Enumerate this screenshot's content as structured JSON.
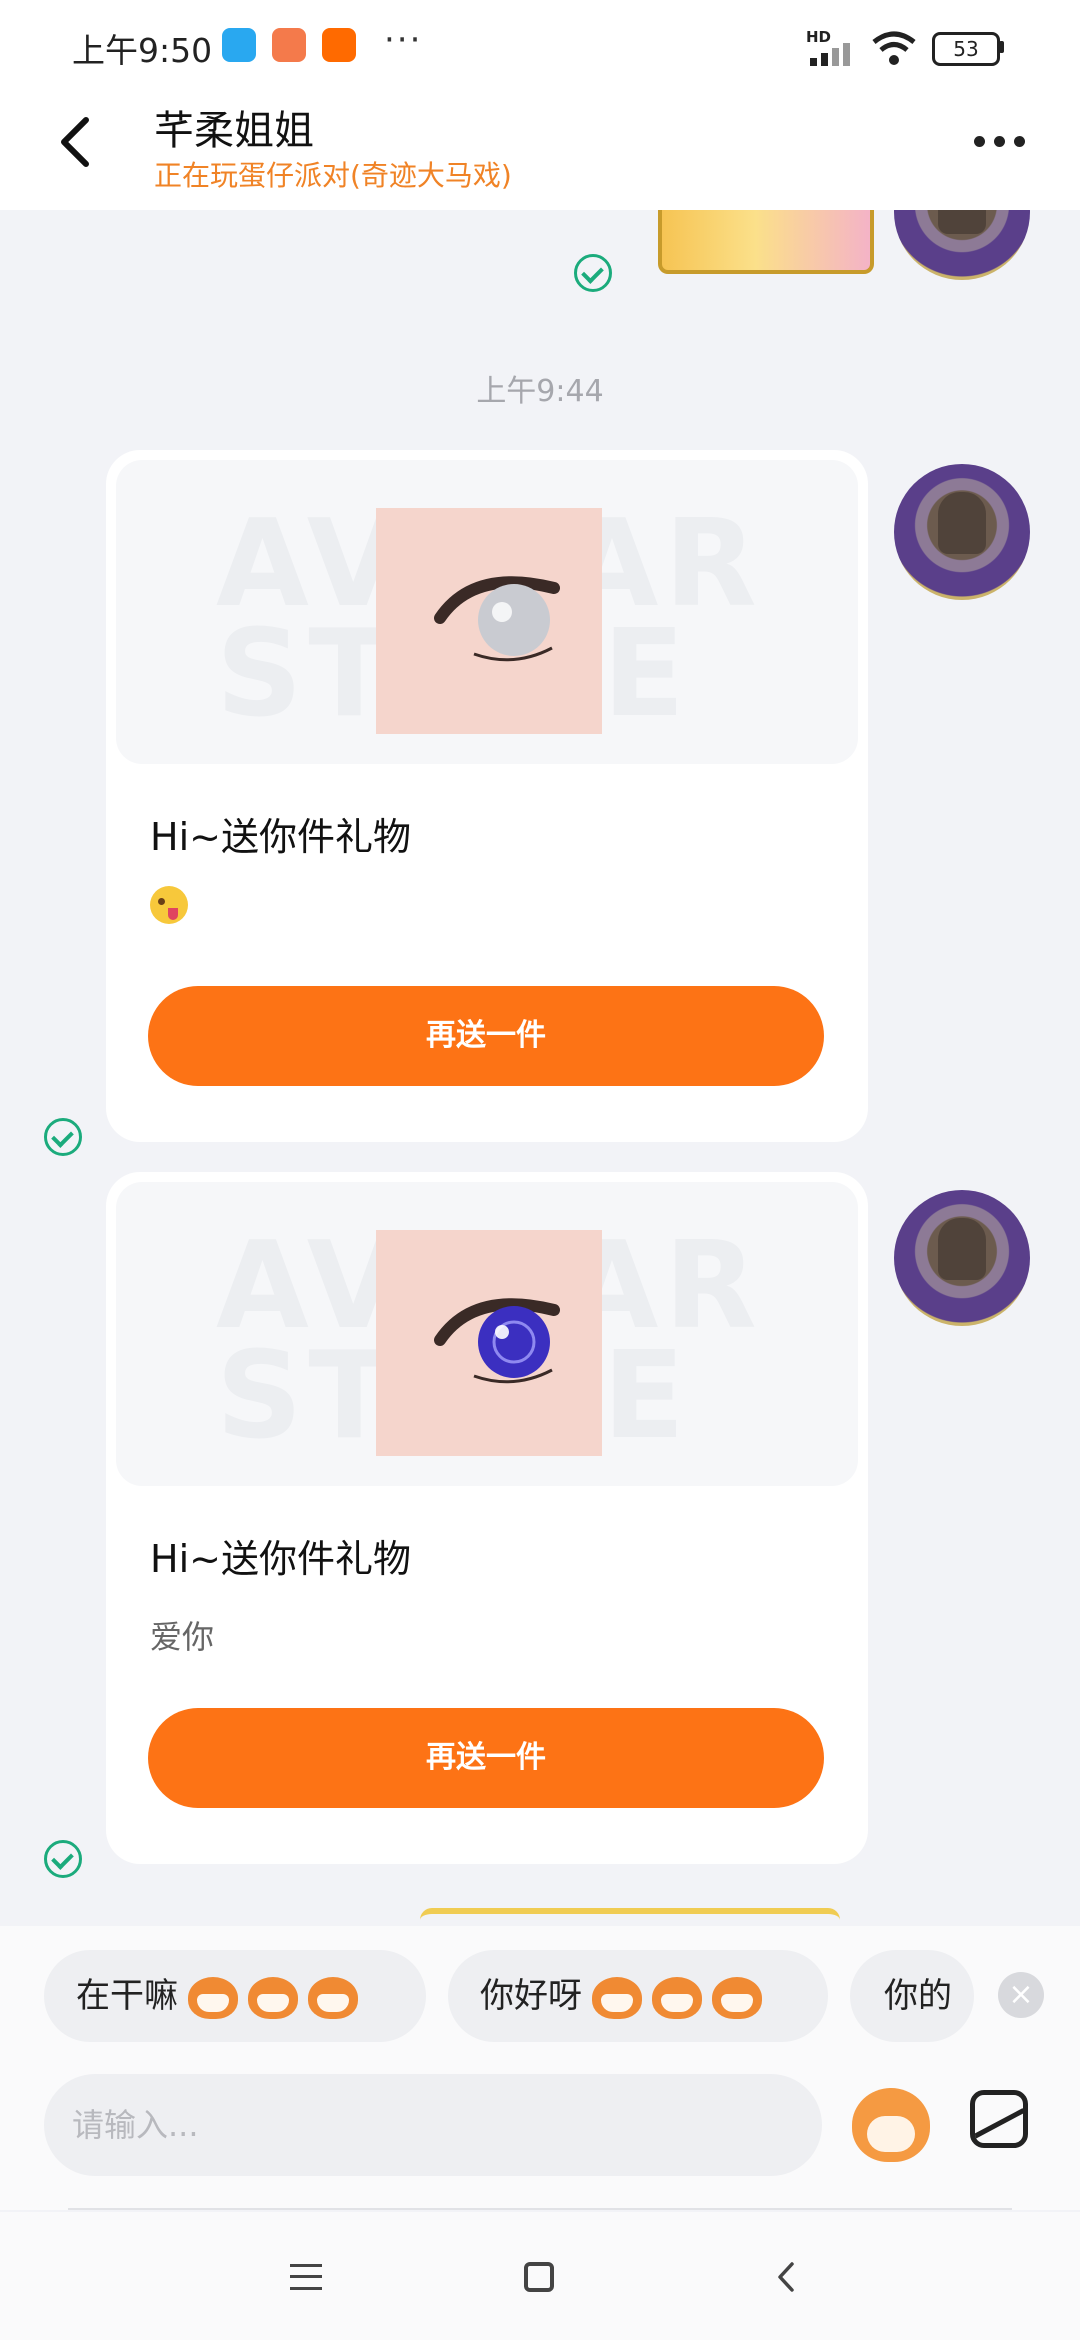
{
  "status_bar": {
    "time": "上午9:50",
    "more": "···",
    "network": "HD",
    "battery": "53"
  },
  "header": {
    "name": "芊柔姐姐",
    "status": "正在玩蛋仔派对(奇迹大马戏)"
  },
  "chat": {
    "timestamp": "上午9:44",
    "watermark": "AVATAR STORE",
    "messages": [
      {
        "title": "Hi~送你件礼物",
        "note": "",
        "button": "再送一件",
        "eye_color": "#c9cbd1"
      },
      {
        "title": "Hi~送你件礼物",
        "note": "爱你",
        "button": "再送一件",
        "eye_color": "#3b2fc0"
      }
    ]
  },
  "quick_replies": [
    "在干嘛",
    "你好呀",
    "你的"
  ],
  "input": {
    "placeholder": "请输入..."
  },
  "colors": {
    "accent": "#fd7315",
    "status_text": "#f08326",
    "sent_check": "#1bab7c"
  },
  "icons": [
    "back-arrow-icon",
    "more-icon",
    "sticker-icon",
    "image-icon",
    "close-icon",
    "menu-icon",
    "home-icon",
    "back-icon"
  ]
}
